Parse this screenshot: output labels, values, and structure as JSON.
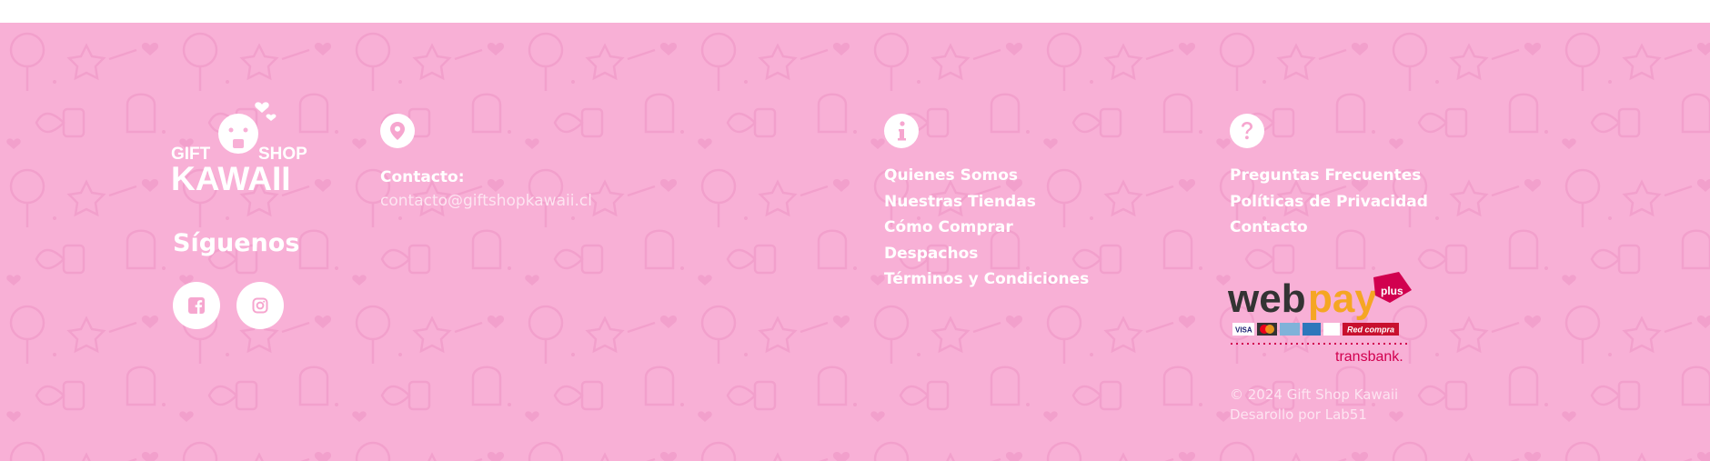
{
  "logo": {
    "line1_left": "GIFT",
    "line1_right": "SHOP",
    "line2": "KAWAII"
  },
  "follow": {
    "title": "Síguenos"
  },
  "social": [
    {
      "name": "facebook-icon"
    },
    {
      "name": "instagram-icon"
    }
  ],
  "contact": {
    "icon": "location-pin-icon",
    "label": "Contacto:",
    "email": "contacto@giftshopkawaii.cl"
  },
  "info": {
    "icon": "info-icon",
    "links": [
      "Quienes Somos",
      "Nuestras Tiendas",
      "Cómo Comprar",
      "Despachos",
      "Términos y Condiciones"
    ]
  },
  "help": {
    "icon": "question-icon",
    "links": [
      "Preguntas Frecuentes",
      "Políticas de Privacidad",
      "Contacto"
    ]
  },
  "payment": {
    "brand_left": "web",
    "brand_right": "pay",
    "badge": "plus",
    "cards": [
      "VISA",
      "Mastercard",
      "Diners",
      "AMEX",
      "Magna",
      "Red compra"
    ],
    "provider": "transbank."
  },
  "footer_note": {
    "copyright": "© 2024 Gift Shop Kawaii",
    "credits": "Desarollo por Lab51"
  },
  "colors": {
    "background": "#f8b0d6",
    "accent": "#f6a6cf",
    "white": "#ffffff",
    "webpay_orange": "#f5a623",
    "transbank_red": "#d1004f"
  }
}
